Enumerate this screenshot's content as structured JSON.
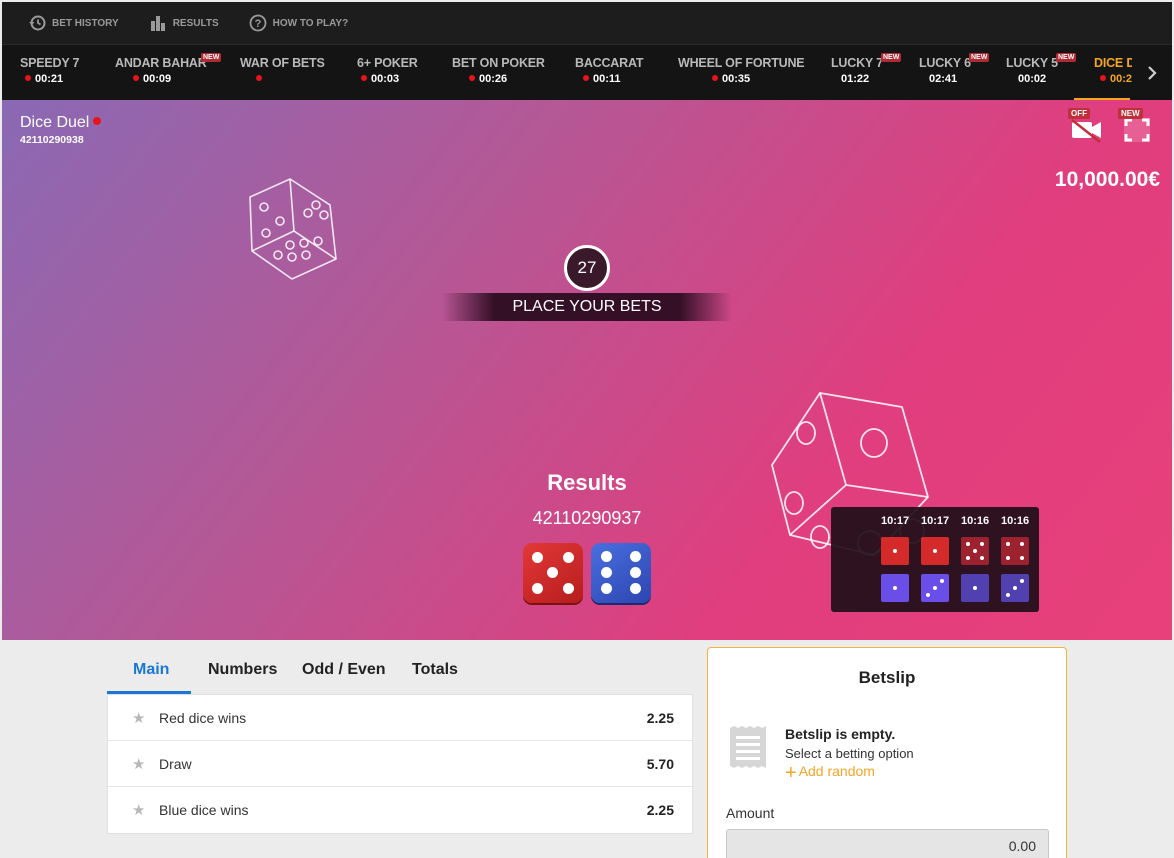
{
  "toolbar": {
    "bet_history": "BET HISTORY",
    "results": "RESULTS",
    "how_to_play": "HOW TO PLAY?"
  },
  "games": [
    {
      "name": "SPEEDY 7",
      "time": "00:21",
      "live": true,
      "new": false
    },
    {
      "name": "ANDAR BAHAR",
      "time": "00:09",
      "live": true,
      "new": true
    },
    {
      "name": "WAR OF BETS",
      "time": "",
      "live": true,
      "new": false
    },
    {
      "name": "6+ POKER",
      "time": "00:03",
      "live": true,
      "new": false
    },
    {
      "name": "BET ON POKER",
      "time": "00:26",
      "live": true,
      "new": false
    },
    {
      "name": "BACCARAT",
      "time": "00:11",
      "live": true,
      "new": false
    },
    {
      "name": "WHEEL OF FORTUNE",
      "time": "00:35",
      "live": true,
      "new": false
    },
    {
      "name": "LUCKY 7",
      "time": "01:22",
      "live": false,
      "new": true
    },
    {
      "name": "LUCKY 6",
      "time": "02:41",
      "live": false,
      "new": true
    },
    {
      "name": "LUCKY 5",
      "time": "00:02",
      "live": false,
      "new": true
    },
    {
      "name": "DICE D",
      "time": "00:2",
      "live": true,
      "new": false
    }
  ],
  "badge_new": "NEW",
  "stage": {
    "title": "Dice Duel",
    "game_id": "42110290938",
    "balance": "10,000.00€",
    "video_toggle": "OFF",
    "fullscreen_badge": "NEW",
    "timer": "27",
    "status": "PLACE YOUR BETS",
    "results_title": "Results",
    "results_id": "42110290937",
    "last_result": {
      "red": 5,
      "blue": 6
    }
  },
  "history": {
    "times": [
      "10:17",
      "10:17",
      "10:16",
      "10:16"
    ],
    "red": [
      1,
      1,
      5,
      4
    ],
    "blue": [
      1,
      3,
      1,
      3
    ]
  },
  "bet_tabs": [
    "Main",
    "Numbers",
    "Odd / Even",
    "Totals"
  ],
  "odds": [
    {
      "label": "Red dice wins",
      "value": "2.25"
    },
    {
      "label": "Draw",
      "value": "5.70"
    },
    {
      "label": "Blue dice wins",
      "value": "2.25"
    }
  ],
  "betslip": {
    "title": "Betslip",
    "empty": "Betslip is empty.",
    "select": "Select a betting option",
    "add_random": "Add random",
    "amount_label": "Amount",
    "amount_value": "0.00"
  },
  "colors": {
    "accent": "#f5a623",
    "tab_active": "#1a78d4",
    "live_dot": "#e8141b",
    "red_die": "#d42a2a",
    "blue_die": "#3a5bd0",
    "history_blue": "#6a4ee8"
  }
}
